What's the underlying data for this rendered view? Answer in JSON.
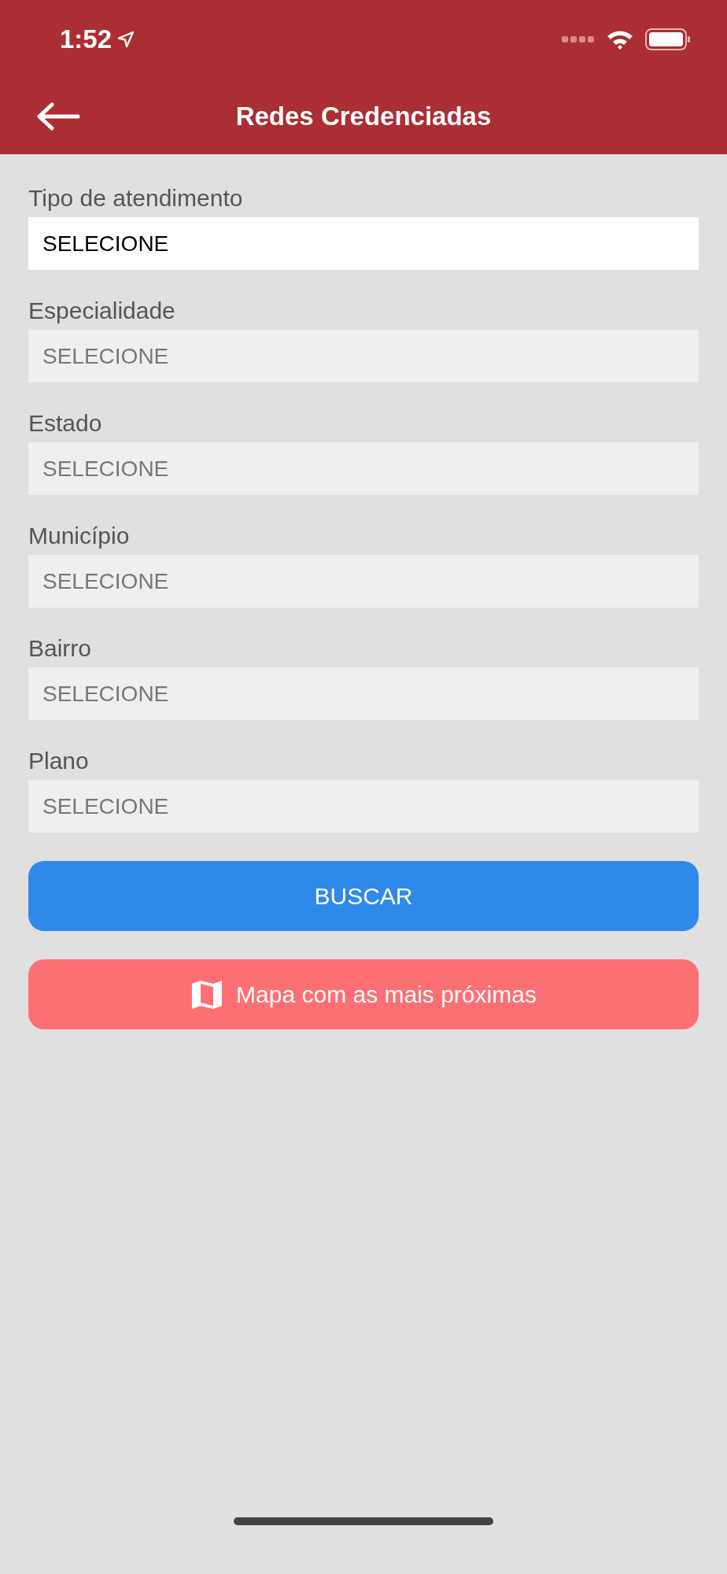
{
  "status_bar": {
    "time": "1:52"
  },
  "header": {
    "title": "Redes Credenciadas"
  },
  "fields": [
    {
      "label": "Tipo de atendimento",
      "value": "SELECIONE",
      "disabled": false
    },
    {
      "label": "Especialidade",
      "value": "SELECIONE",
      "disabled": true
    },
    {
      "label": "Estado",
      "value": "SELECIONE",
      "disabled": true
    },
    {
      "label": "Município",
      "value": "SELECIONE",
      "disabled": true
    },
    {
      "label": "Bairro",
      "value": "SELECIONE",
      "disabled": true
    },
    {
      "label": "Plano",
      "value": "SELECIONE",
      "disabled": true
    }
  ],
  "buttons": [
    {
      "label": "BUSCAR",
      "kind": "primary"
    },
    {
      "label": "Mapa com as mais próximas",
      "kind": "map"
    }
  ]
}
